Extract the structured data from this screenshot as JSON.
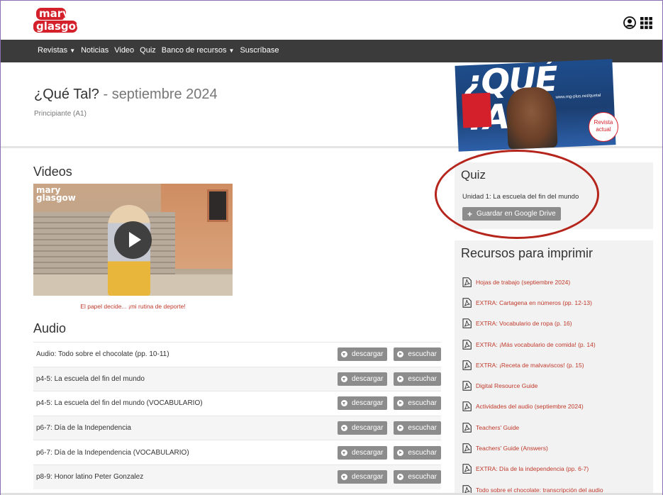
{
  "brand": {
    "logo_line1": "mary",
    "logo_line2": "glasgow"
  },
  "nav": {
    "items": [
      {
        "label": "Revistas",
        "caret": "▼"
      },
      {
        "label": "Noticias"
      },
      {
        "label": "Video"
      },
      {
        "label": "Quiz"
      },
      {
        "label": "Banco de recursos",
        "caret": "▼"
      },
      {
        "label": "Suscríbase"
      }
    ]
  },
  "hero": {
    "title": "¿Qué Tal?",
    "separator": " - ",
    "month": "septiembre 2024",
    "level": "Principiante (A1)",
    "cover_title": "¿QUÉ TAL?",
    "cover_url": "www.mg-plus.net/quetal",
    "badge": "Revista actual"
  },
  "videos": {
    "heading": "Videos",
    "caption": "El papel decide... ¡mi rutina de deporte!"
  },
  "audio": {
    "heading": "Audio",
    "download_label": "descargar",
    "listen_label": "escuchar",
    "rows": [
      "Audio: Todo sobre el chocolate (pp. 10-11)",
      "p4-5: La escuela del fin del mundo",
      "p4-5: La escuela del fin del mundo (VOCABULARIO)",
      "p6-7: Día de la Independencia",
      "p6-7: Día de la Independencia (VOCABULARIO)",
      "p8-9: Honor latino Peter Gonzalez"
    ]
  },
  "quiz": {
    "heading": "Quiz",
    "unit": "Unidad 1: La escuela del fin del mundo",
    "drive_label": "Guardar en Google Drive",
    "drive_plus": "+"
  },
  "resources": {
    "heading": "Recursos para imprimir",
    "items": [
      "Hojas de trabajo (septiembre 2024)",
      "EXTRA: Cartagena en números (pp. 12-13)",
      "EXTRA: Vocabulario de ropa (p. 16)",
      "EXTRA: ¡Más vocabulario de comida! (p. 14)",
      "EXTRA: ¡Receta de malvaviscos! (p. 15)",
      "Digital Resource Guide",
      "Actividades del audio (septiembre 2024)",
      "Teachers' Guide",
      "Teachers' Guide (Answers)",
      "EXTRA: Día de la independencia (pp. 6-7)",
      "Todo sobre el chocolate: transcripción del audio"
    ]
  },
  "colors": {
    "accent": "#c0392b",
    "nav_bg": "#3b3b3b",
    "button": "#8c8c8c",
    "annotation": "#b5251c"
  }
}
